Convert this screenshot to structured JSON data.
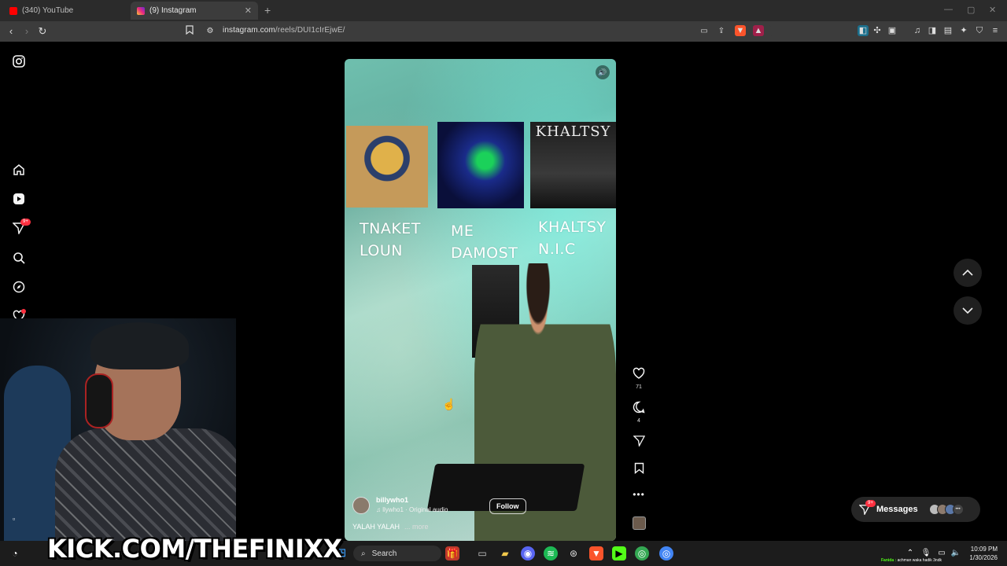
{
  "browser": {
    "tabs": [
      {
        "title": "(340) YouTube",
        "active": false
      },
      {
        "title": "(9) Instagram",
        "active": true
      }
    ],
    "url": {
      "domain": "instagram.com",
      "path": "/reels/DUI1cIrEjwE/"
    }
  },
  "reel": {
    "albums": [
      {
        "caption_line1": "TNAKET",
        "caption_line2": "LOUN"
      },
      {
        "caption_line1": "ME",
        "caption_line2": "DAMOST"
      },
      {
        "caption_line1": "KHALTSY",
        "caption_line2": "N.I.C",
        "cover_text": "KHALTSY"
      }
    ],
    "username": "billywho1",
    "audio": "llywho1 · Original audio",
    "follow_label": "Follow",
    "caption": "YALAH YALAH",
    "more_label": "... more",
    "likes": "71",
    "comments": "4"
  },
  "sidebar": {
    "notification_badge": "9+"
  },
  "messages": {
    "label": "Messages",
    "badge": "9+"
  },
  "overlay": {
    "kick_text": "KICK.COM/THEFINIXX"
  },
  "taskbar": {
    "search_label": "Search",
    "time": "10:09 PM",
    "date": "1/30/2026",
    "ticker_name": "Fanida :",
    "ticker_text": "achman waka hadik 3ndk"
  },
  "colors": {
    "accent_kick": "#53fc18",
    "badge": "#ff3040"
  }
}
